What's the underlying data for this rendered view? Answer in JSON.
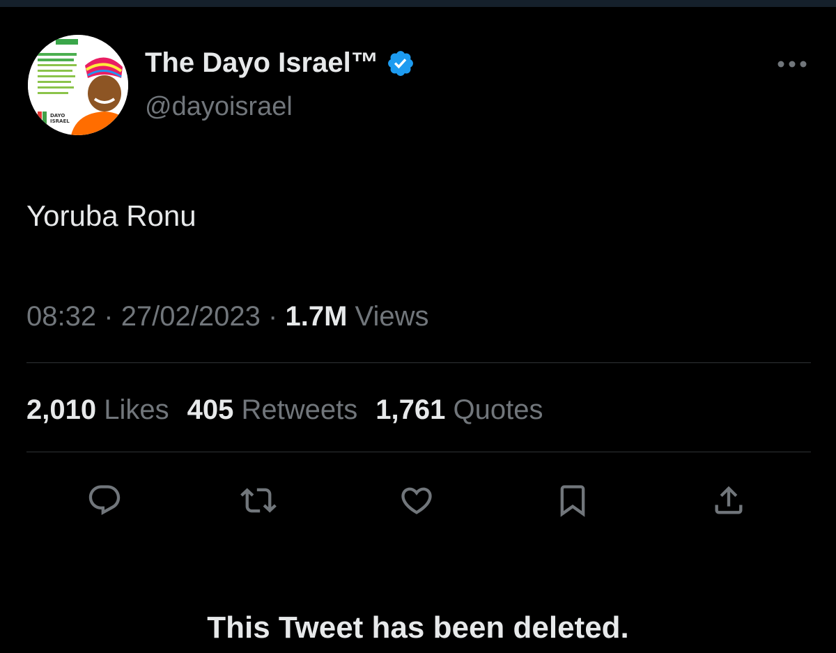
{
  "author": {
    "display_name": "The Dayo Israel™",
    "handle": "@dayoisrael",
    "verified": true,
    "avatar_text": "DAYO ISRAEL"
  },
  "tweet": {
    "text": "Yoruba Ronu",
    "time": "08:32",
    "separator": "·",
    "date": "27/02/2023",
    "views_count": "1.7M",
    "views_label": "Views"
  },
  "stats": {
    "likes_count": "2,010",
    "likes_label": "Likes",
    "retweets_count": "405",
    "retweets_label": "Retweets",
    "quotes_count": "1,761",
    "quotes_label": "Quotes"
  },
  "actions": {
    "icons": [
      "reply-icon",
      "retweet-icon",
      "like-icon",
      "bookmark-icon",
      "share-icon"
    ]
  },
  "notice": {
    "text": "This Tweet has been deleted."
  },
  "colors": {
    "background": "#000000",
    "primary_text": "#e7e9ea",
    "secondary_text": "#71767b",
    "verified_blue": "#1d9bf0",
    "divider": "#2f3336"
  }
}
